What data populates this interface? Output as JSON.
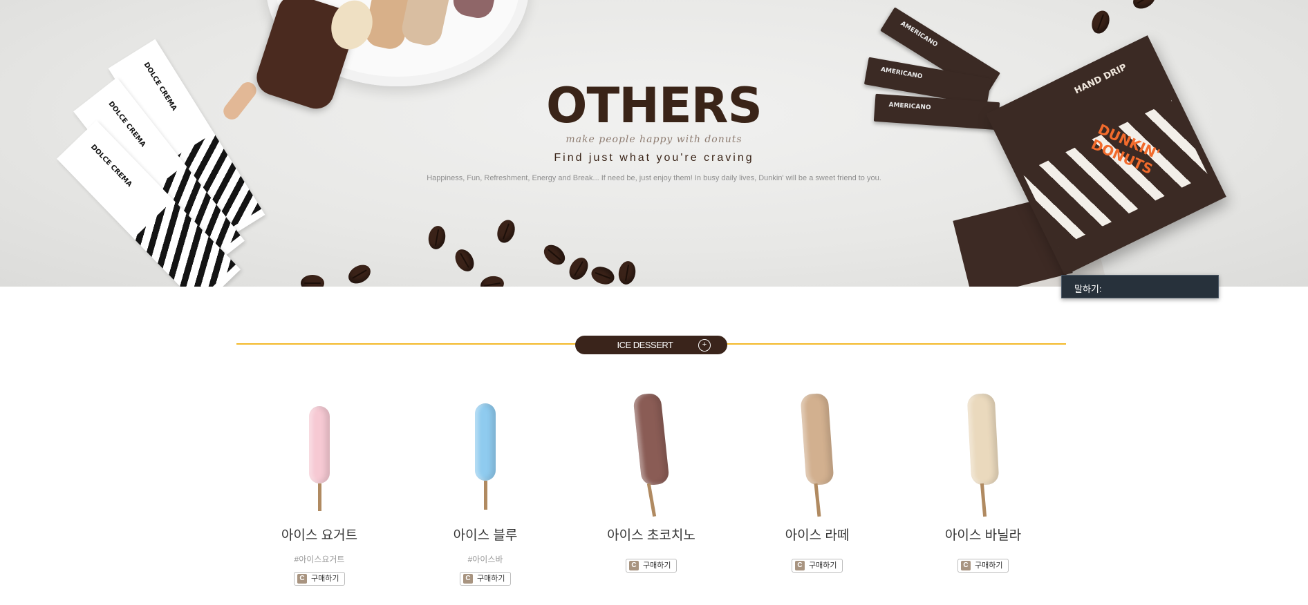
{
  "hero": {
    "title": "OTHERS",
    "script_line": "make people happy with donuts",
    "subtitle": "Find just what you're craving",
    "description": "Happiness, Fun, Refreshment, Energy and Break... If need be, just enjoy them! In busy daily lives, Dunkin' will be a sweet friend to you.",
    "sachet_label": "DOLCE CREMA",
    "stick_label": "AMERICANO",
    "box_label": "HAND DRIP",
    "box_logo": "DUNKIN' DONUTS"
  },
  "chat": {
    "label": "말하기:"
  },
  "section": {
    "title": "ICE DESSERT",
    "more_icon": "+"
  },
  "products": [
    {
      "name": "아이스 요거트",
      "tag": "#아이스요거트",
      "buy": "구매하기",
      "color": "#f6c9d3"
    },
    {
      "name": "아이스 블루",
      "tag": "#아이스바",
      "buy": "구매하기",
      "color": "#8fcbef"
    },
    {
      "name": "아이스 초코치노",
      "tag": "",
      "buy": "구매하기",
      "color": "#8a5c55"
    },
    {
      "name": "아이스 라떼",
      "tag": "",
      "buy": "구매하기",
      "color": "#d2b08f"
    },
    {
      "name": "아이스 바닐라",
      "tag": "",
      "buy": "구매하기",
      "color": "#ead9bd"
    }
  ],
  "buy_icon": "C"
}
